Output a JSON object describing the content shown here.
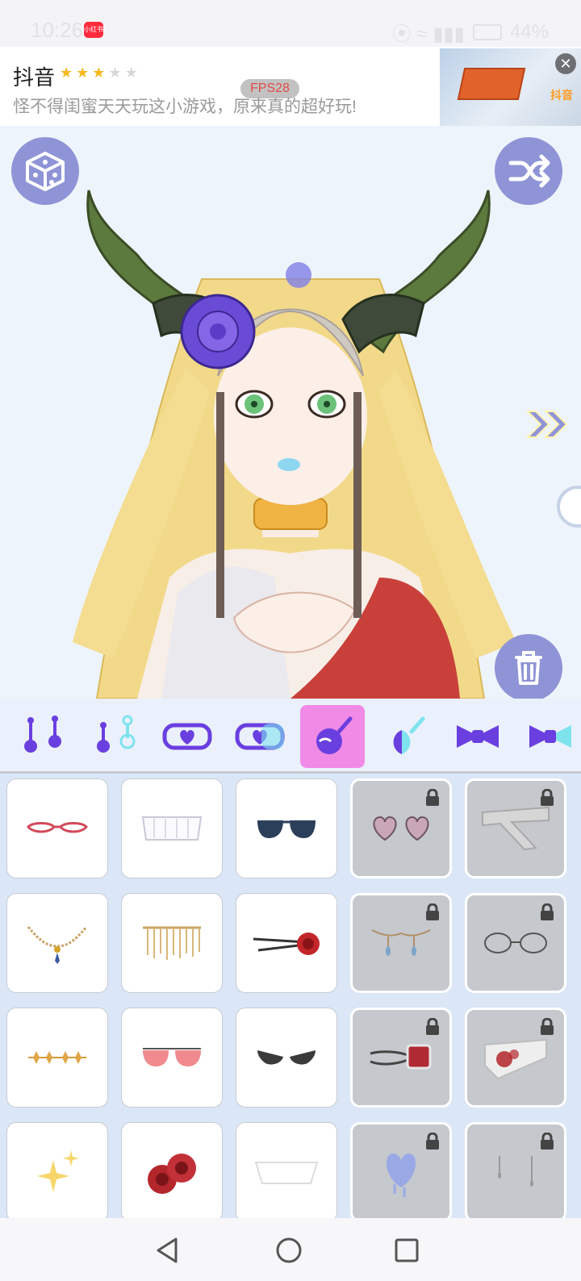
{
  "status_bar": {
    "time": "10:26",
    "badge": "小红书",
    "battery": "44%"
  },
  "ad": {
    "app_name": "抖音",
    "rating": 3,
    "rating_max": 5,
    "description": "怪不得闺蜜天天玩这小游戏，原来真的超好玩!",
    "fps_label": "FPS28",
    "thumb_text": "抖音",
    "close_icon": "close-icon"
  },
  "stage": {
    "top_left_icon": "dice-icon",
    "top_right_icon": "shuffle-icon",
    "right_icon": "double-chevron-right-icon",
    "bottom_right_icon": "trash-icon"
  },
  "categories": [
    {
      "icon": "earrings-pair-icon",
      "active": false
    },
    {
      "icon": "earring-single-icon",
      "active": false
    },
    {
      "icon": "heart-choker-icon",
      "active": false
    },
    {
      "icon": "heart-choker-alt-icon",
      "active": false
    },
    {
      "icon": "face-accessory-icon",
      "active": true
    },
    {
      "icon": "face-accessory-alt-icon",
      "active": false
    },
    {
      "icon": "bow-icon",
      "active": false
    },
    {
      "icon": "bow-alt-icon",
      "active": false
    }
  ],
  "items": [
    {
      "name": "red-glasses",
      "locked": false
    },
    {
      "name": "white-frill",
      "locked": false
    },
    {
      "name": "sunglasses",
      "locked": false
    },
    {
      "name": "heart-glasses",
      "locked": true
    },
    {
      "name": "bandage",
      "locked": true
    },
    {
      "name": "gold-chain",
      "locked": false
    },
    {
      "name": "gold-fringe",
      "locked": false
    },
    {
      "name": "rose-pin",
      "locked": false
    },
    {
      "name": "drop-chain",
      "locked": true
    },
    {
      "name": "round-glasses",
      "locked": true
    },
    {
      "name": "golden-leaves",
      "locked": false
    },
    {
      "name": "pink-aviators",
      "locked": false
    },
    {
      "name": "cat-eye-shades",
      "locked": false
    },
    {
      "name": "monocle-chain",
      "locked": true
    },
    {
      "name": "bloody-bandage",
      "locked": true
    },
    {
      "name": "sparkles",
      "locked": false
    },
    {
      "name": "red-roses",
      "locked": false
    },
    {
      "name": "clear-mask",
      "locked": false
    },
    {
      "name": "melting-heart",
      "locked": true
    },
    {
      "name": "tear-drops",
      "locked": true
    }
  ],
  "colors": {
    "accent_purple": "#8f94d6",
    "active_tab": "#f08ae6",
    "icon_purple": "#6a3fe0",
    "icon_cyan": "#7fe3ee"
  }
}
